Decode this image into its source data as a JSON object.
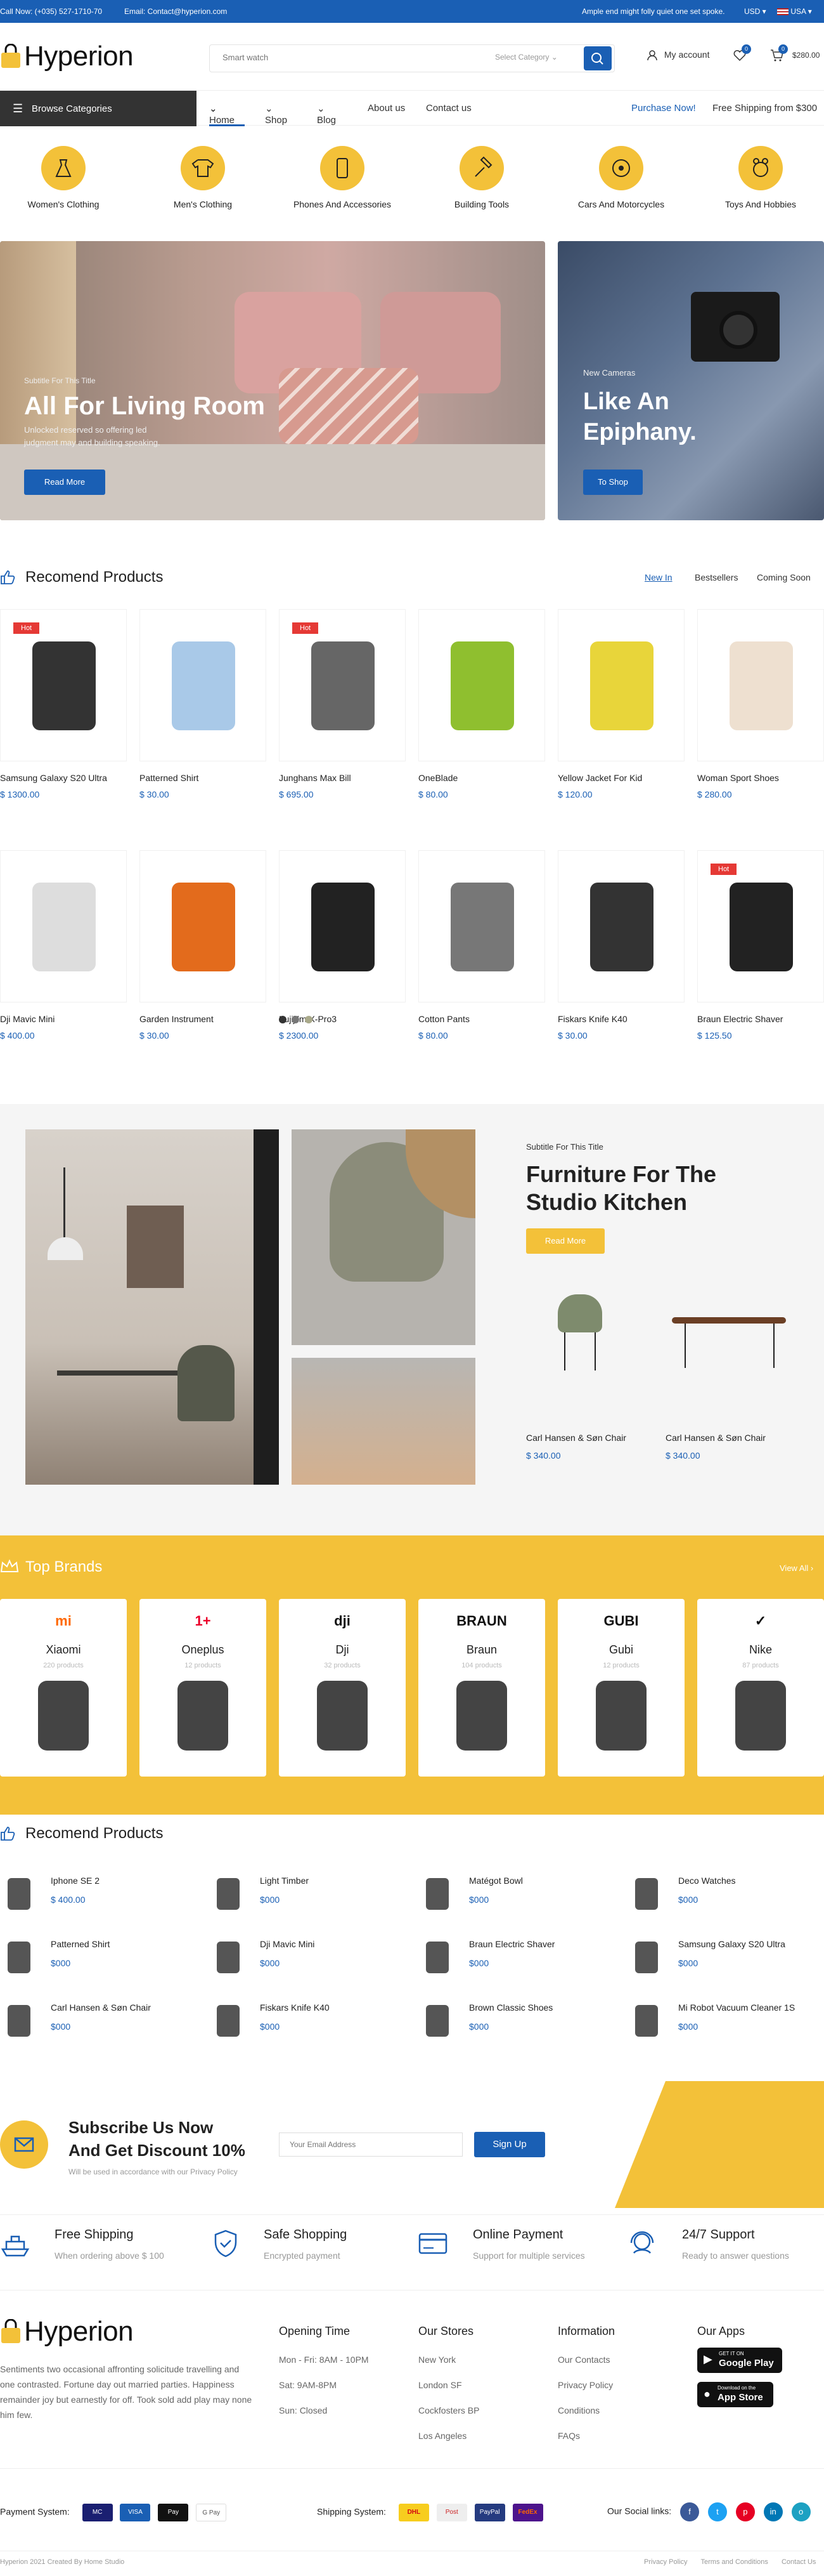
{
  "topbar": {
    "call": "Call Now: (+035) 527-1710-70",
    "email": "Email: Contact@hyperion.com",
    "message": "Ample end might folly quiet one set spoke.",
    "currency": "USD",
    "language": "USA"
  },
  "header": {
    "logo": "Hyperion",
    "search_placeholder": "Smart watch",
    "category_select": "Select Category",
    "account": "My account",
    "wishlist_count": "0",
    "cart_count": "0",
    "cart_total": "$280.00"
  },
  "nav": {
    "browse": "Browse Categories",
    "links": [
      "Home",
      "Shop",
      "Blog",
      "About us",
      "Contact us"
    ],
    "purchase": "Purchase Now!",
    "shipping": "Free Shipping from $300"
  },
  "categories": [
    {
      "label": "Women's Clothing",
      "icon": "dress-icon"
    },
    {
      "label": "Men's Clothing",
      "icon": "shirt-icon"
    },
    {
      "label": "Phones And Accessories",
      "icon": "phone-icon"
    },
    {
      "label": "Building Tools",
      "icon": "hammer-icon"
    },
    {
      "label": "Cars And Motorcycles",
      "icon": "car-icon"
    },
    {
      "label": "Toys And Hobbies",
      "icon": "toy-icon"
    }
  ],
  "banners": {
    "left": {
      "subtitle": "Subtitle For This Title",
      "title": "All For Living Room",
      "text1": "Unlocked reserved so offering led",
      "text2": "judgment may and building speaking.",
      "button": "Read More"
    },
    "right": {
      "subtitle": "New Cameras",
      "title1": "Like An",
      "title2": "Epiphany.",
      "button": "To Shop"
    }
  },
  "recommend": {
    "title": "Recomend Products",
    "tabs": [
      "New In",
      "Bestsellers",
      "Coming Soon"
    ],
    "row1": [
      {
        "name": "Samsung Galaxy S20 Ultra",
        "price": "$ 1300.00",
        "badge": "Hot"
      },
      {
        "name": "Patterned Shirt",
        "price": "$ 30.00",
        "badge": ""
      },
      {
        "name": "Junghans Max Bill",
        "price": "$ 695.00",
        "badge": "Hot"
      },
      {
        "name": "OneBlade",
        "price": "$ 80.00",
        "badge": ""
      },
      {
        "name": "Yellow Jacket For Kid",
        "price": "$ 120.00",
        "badge": ""
      },
      {
        "name": "Woman Sport Shoes",
        "price": "$ 280.00",
        "badge": ""
      }
    ],
    "row2": [
      {
        "name": "Dji Mavic Mini",
        "price": "$ 400.00",
        "badge": ""
      },
      {
        "name": "Garden Instrument",
        "price": "$ 30.00",
        "badge": ""
      },
      {
        "name": "Fujijilm X-Pro3",
        "price": "$ 2300.00",
        "badge": ""
      },
      {
        "name": "Cotton Pants",
        "price": "$ 80.00",
        "badge": ""
      },
      {
        "name": "Fiskars Knife K40",
        "price": "$ 30.00",
        "badge": ""
      },
      {
        "name": "Braun Electric Shaver",
        "price": "$ 125.50",
        "badge": "Hot"
      }
    ]
  },
  "furniture": {
    "subtitle": "Subtitle For This Title",
    "title1": "Furniture For The",
    "title2": "Studio Kitchen",
    "button": "Read More",
    "items": [
      {
        "name": "Carl Hansen & Søn Chair",
        "price": "$ 340.00"
      },
      {
        "name": "Carl Hansen & Søn Chair",
        "price": "$ 340.00"
      }
    ]
  },
  "brands": {
    "title": "Top Brands",
    "view_all": "View All",
    "items": [
      {
        "name": "Xiaomi",
        "count": "220 products",
        "logo": "mi"
      },
      {
        "name": "Oneplus",
        "count": "12 products",
        "logo": "1+"
      },
      {
        "name": "Dji",
        "count": "32 products",
        "logo": "dji"
      },
      {
        "name": "Braun",
        "count": "104 products",
        "logo": "BRAUN"
      },
      {
        "name": "Gubi",
        "count": "12 products",
        "logo": "GUBI"
      },
      {
        "name": "Nike",
        "count": "87 products",
        "logo": "✓"
      }
    ]
  },
  "recommend2": {
    "title": "Recomend Products",
    "items": [
      {
        "name": "Iphone SE 2",
        "price": "$ 400.00"
      },
      {
        "name": "Light Timber",
        "price": "$000"
      },
      {
        "name": "Matégot Bowl",
        "price": "$000"
      },
      {
        "name": "Deco Watches",
        "price": "$000"
      },
      {
        "name": "Patterned Shirt",
        "price": "$000"
      },
      {
        "name": "Dji Mavic Mini",
        "price": "$000"
      },
      {
        "name": "Braun Electric Shaver",
        "price": "$000"
      },
      {
        "name": "Samsung Galaxy S20 Ultra",
        "price": "$000"
      },
      {
        "name": "Carl Hansen & Søn Chair",
        "price": "$000"
      },
      {
        "name": "Fiskars Knife K40",
        "price": "$000"
      },
      {
        "name": "Brown Classic Shoes",
        "price": "$000"
      },
      {
        "name": "Mi Robot Vacuum Cleaner 1S",
        "price": "$000"
      }
    ]
  },
  "subscribe": {
    "title1": "Subscribe Us Now",
    "title2": "And Get Discount 10%",
    "note": "Will be used in accordance with our Privacy Policy",
    "placeholder": "Your Email Address",
    "button": "Sign Up"
  },
  "features": [
    {
      "title": "Free Shipping",
      "sub": "When ordering above $ 100"
    },
    {
      "title": "Safe Shopping",
      "sub": "Encrypted payment"
    },
    {
      "title": "Online Payment",
      "sub": "Support for multiple services"
    },
    {
      "title": "24/7 Support",
      "sub": "Ready to answer questions"
    }
  ],
  "footer": {
    "logo": "Hyperion",
    "about": "Sentiments two occasional affronting solicitude travelling and one contrasted. Fortune day out married parties. Happiness remainder joy but earnestly for off. Took sold add play may none him few.",
    "opening_title": "Opening Time",
    "opening": [
      "Mon - Fri: 8AM - 10PM",
      "Sat: 9AM-8PM",
      "Sun: Closed"
    ],
    "stores_title": "Our Stores",
    "stores": [
      "New York",
      "London SF",
      "Cockfosters BP",
      "Los Angeles"
    ],
    "info_title": "Information",
    "info": [
      "Our Contacts",
      "Privacy Policy",
      "Conditions",
      "FAQs"
    ],
    "apps_title": "Our Apps",
    "google_small": "GET IT ON",
    "google": "Google Play",
    "apple_small": "Download on the",
    "apple": "App Store",
    "payment_label": "Payment System:",
    "payments": [
      "MC",
      "VISA",
      "Pay",
      "G Pay"
    ],
    "shipping_label": "Shipping System:",
    "shippers": [
      "DHL",
      "Post",
      "PayPal",
      "FedEx"
    ],
    "social_label": "Our Social links:",
    "socials": [
      "f",
      "t",
      "p",
      "in",
      "o"
    ],
    "copyright": "Hyperion 2021 Created By Home Studio",
    "bottom_links": [
      "Privacy Policy",
      "Terms and Conditions",
      "Contact Us"
    ]
  }
}
